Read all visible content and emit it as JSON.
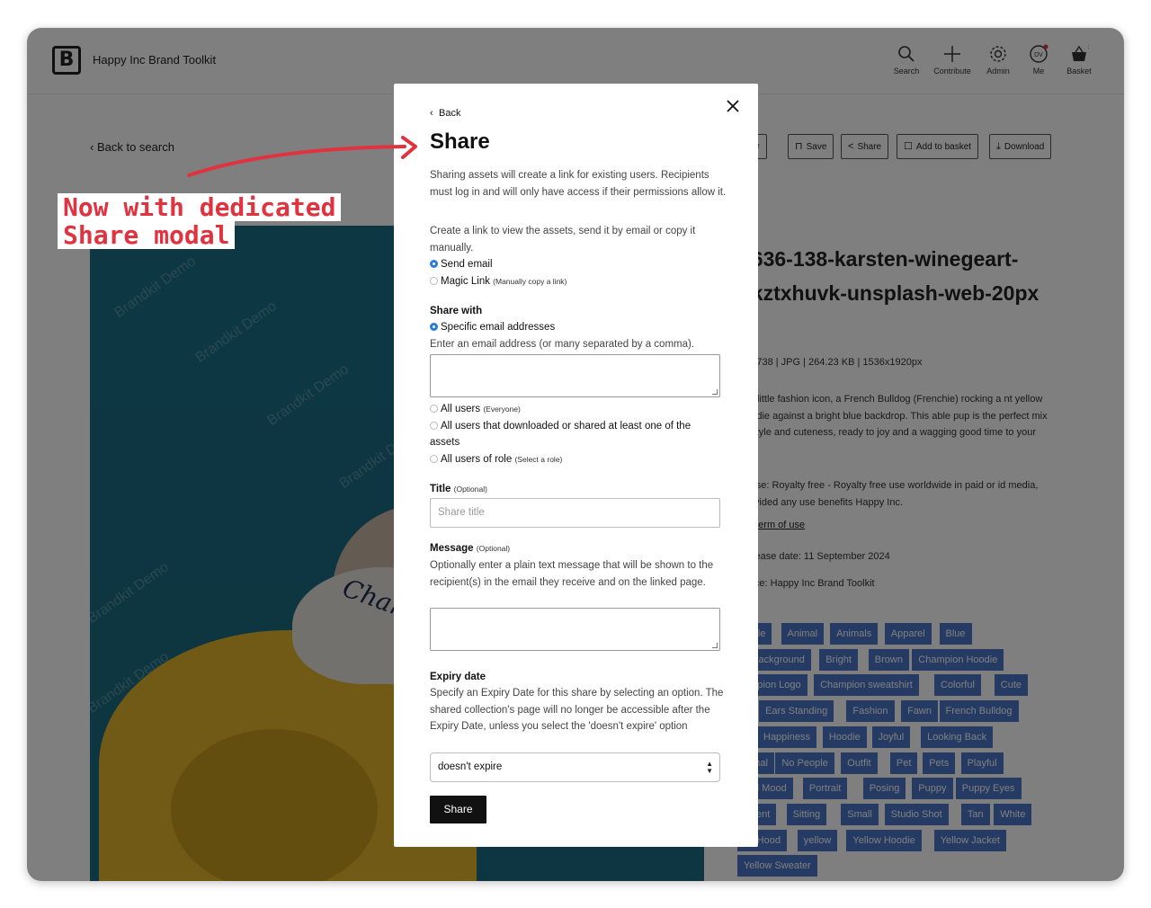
{
  "header": {
    "brand_name": "Happy Inc Brand Toolkit",
    "logo_letter": "B",
    "nav": [
      {
        "label": "Search",
        "icon": "search-icon"
      },
      {
        "label": "Contribute",
        "icon": "plus-icon"
      },
      {
        "label": "Admin",
        "icon": "gear-icon"
      },
      {
        "label": "Me",
        "icon": "user-initials-icon",
        "initials": "DV"
      },
      {
        "label": "Basket",
        "icon": "basket-icon",
        "badge": "2"
      }
    ]
  },
  "page": {
    "back_to_search": "Back to search",
    "watermark": "Brandkit Demo",
    "hood_text": "Champion",
    "actions": [
      {
        "label": "age",
        "icon": "image-icon"
      },
      {
        "label": "Save",
        "icon": "bookmark-icon"
      },
      {
        "label": "Share",
        "icon": "share-icon"
      },
      {
        "label": "Add to basket",
        "icon": "basket-icon"
      },
      {
        "label": "Download",
        "icon": "download-icon"
      }
    ],
    "asset_title": "2636-138-karsten-winegeart-6kztxhuvk-unsplash-web-20px",
    "asset_meta": "656738 | JPG | 264.23 KB | 1536x1920px",
    "description": "our little fashion icon, a French Bulldog (Frenchie) rocking a nt yellow hoodie against a bright blue backdrop. This able pup is the perfect mix of style and cuteness, ready to joy and a wagging good time to your day!",
    "license": "cense: Royalty free - Royalty free use worldwide in paid or id media, provided any use benefits Happy Inc.",
    "terms_link": "full term of use",
    "release_date": "Release date: 11 September 2024",
    "source": "ource: Happy Inc Brand Toolkit",
    "tags": [
      [
        "rable",
        "Animal",
        "Animals",
        "Apparel",
        "Blue"
      ],
      [
        "e Background",
        "Bright",
        "Brown",
        "Champion Hoodie"
      ],
      [
        "ampion Logo",
        "Champion sweatshirt",
        "Colorful",
        "Cute"
      ],
      [
        "g",
        "Ears Standing",
        "Fashion",
        "Fawn",
        "French Bulldog"
      ],
      [
        "",
        "Happiness",
        "Hoodie",
        "Joyful",
        "Looking Back"
      ],
      [
        "mmal",
        "No People",
        "Outfit",
        "Pet",
        "Pets",
        "Playful"
      ],
      [
        "yful Mood",
        "Portrait",
        "Posing",
        "Puppy",
        "Puppy Eyes"
      ],
      [
        "liment",
        "Sitting",
        "Small",
        "Studio Shot",
        "Tan",
        "White"
      ],
      [
        "ite Hood",
        "yellow",
        "Yellow Hoodie",
        "Yellow Jacket"
      ],
      [
        "Yellow Sweater"
      ]
    ]
  },
  "modal": {
    "back": "Back",
    "title": "Share",
    "intro": "Sharing assets will create a link for existing users. Recipients must log in and will only have access if their permissions allow it.",
    "create_text": "Create a link to view the assets, send it by email or copy it manually.",
    "method_options": [
      {
        "label": "Send email",
        "note": "",
        "selected": true
      },
      {
        "label": "Magic Link",
        "note": "(Manually copy a link)",
        "selected": false
      }
    ],
    "share_with_heading": "Share with",
    "share_with_options": [
      {
        "label": "Specific email addresses",
        "note": "",
        "selected": true
      },
      {
        "label": "All users",
        "note": "(Everyone)",
        "selected": false
      },
      {
        "label": "All users that downloaded or shared at least one of the assets",
        "note": "",
        "selected": false
      },
      {
        "label": "All users of role",
        "note": "(Select a role)",
        "selected": false
      }
    ],
    "email_hint": "Enter an email address (or many separated by a comma).",
    "email_value": "",
    "title_label": "Title",
    "title_optional": "(Optional)",
    "title_placeholder": "Share title",
    "message_label": "Message",
    "message_optional": "(Optional)",
    "message_hint": "Optionally enter a plain text message that will be shown to the recipient(s) in the email they receive and on the linked page.",
    "message_value": "",
    "expiry_label": "Expiry date",
    "expiry_hint": "Specify an Expiry Date for this share by selecting an option. The shared collection's page will no longer be accessible after the Expiry Date, unless you select the 'doesn't expire' option",
    "expiry_value": "doesn't expire",
    "submit": "Share"
  },
  "annotation": {
    "line1": "Now with dedicated",
    "line2": "Share modal",
    "color": "#e0323f"
  }
}
